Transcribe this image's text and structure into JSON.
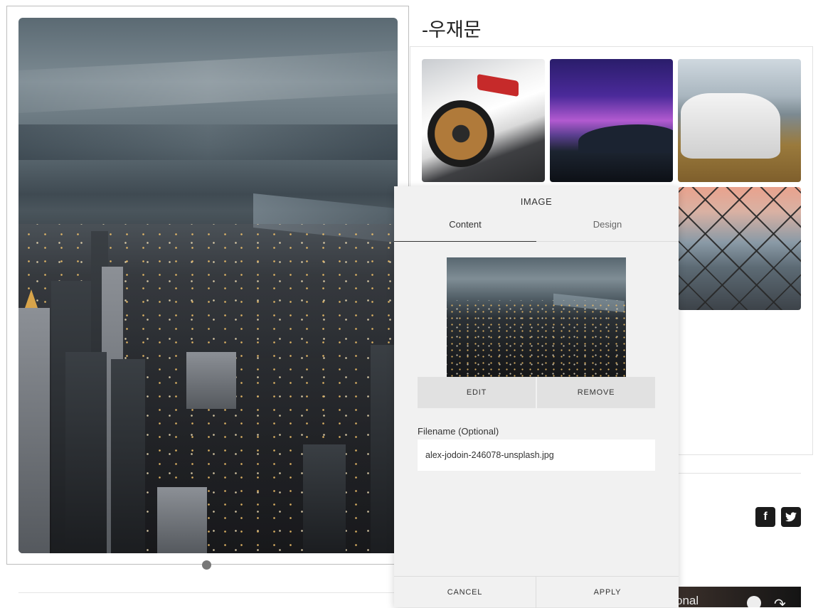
{
  "post": {
    "title": "-우재문"
  },
  "editor": {
    "title": "IMAGE",
    "tabs": [
      {
        "label": "Content",
        "active": true
      },
      {
        "label": "Design",
        "active": false
      }
    ],
    "buttons": {
      "edit": "EDIT",
      "remove": "REMOVE",
      "cancel": "CANCEL",
      "apply": "APPLY"
    },
    "filename": {
      "label": "Filename (Optional)",
      "value": "alex-jodoin-246078-unsplash.jpg"
    }
  },
  "social": {
    "facebook": "f",
    "twitter": "🐦"
  },
  "video": {
    "caption_fragment": "onal"
  },
  "icons": [
    "facebook-icon",
    "twitter-icon",
    "clock-icon",
    "share-arrow-icon"
  ],
  "colors": {
    "panel_bg": "#f1f1f1",
    "button_bg": "#e1e1e1",
    "social_bg": "#1b1b1b"
  }
}
